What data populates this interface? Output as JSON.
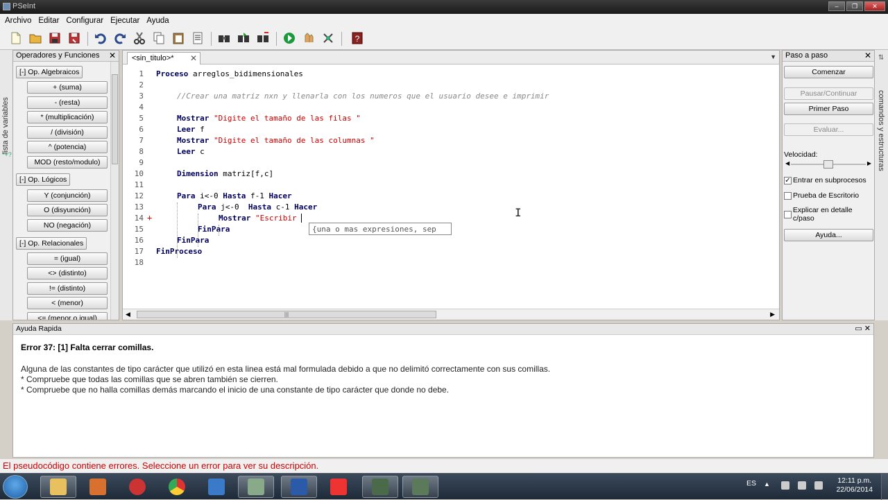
{
  "window": {
    "title": "PSeInt"
  },
  "menu": [
    "Archivo",
    "Editar",
    "Configurar",
    "Ejecutar",
    "Ayuda"
  ],
  "toolbar_icons": [
    "new-file-icon",
    "open-folder-icon",
    "save-icon",
    "save-as-icon",
    "undo-icon",
    "redo-icon",
    "cut-icon",
    "copy-icon",
    "paste-icon",
    "indent-icon",
    "search-icon",
    "find-next-icon",
    "replace-icon",
    "run-icon",
    "step-icon",
    "debug-icon",
    "help-book-icon"
  ],
  "left_tab": {
    "label": "lista de variables",
    "icon_text": "*+?"
  },
  "operators_panel": {
    "title": "Operadores y Funciones",
    "groups": [
      {
        "label": "[-]  Op. Algebraicos",
        "items": [
          "+ (suma)",
          "- (resta)",
          "* (multiplicación)",
          "/ (división)",
          "^ (potencia)",
          "MOD (resto/modulo)"
        ]
      },
      {
        "label": "[-]  Op. Lógicos",
        "items": [
          "Y (conjunción)",
          "O (disyunción)",
          "NO (negación)"
        ]
      },
      {
        "label": "[-]  Op. Relacionales",
        "items": [
          "= (igual)",
          "<> (distinto)",
          "!= (distinto)",
          "< (menor)",
          "<= (menor o igual)"
        ]
      }
    ]
  },
  "editor": {
    "tab_label": "<sin_titulo>*",
    "lines": [
      {
        "n": "1",
        "indent": 0,
        "parts": [
          [
            "kw",
            "Proceso"
          ],
          [
            "t",
            " arreglos_bidimensionales"
          ]
        ]
      },
      {
        "n": "2",
        "indent": 0,
        "parts": []
      },
      {
        "n": "3",
        "indent": 1,
        "parts": [
          [
            "cm",
            "//Crear una matriz nxn y llenarla con los numeros que el usuario desee e imprimir"
          ]
        ]
      },
      {
        "n": "4",
        "indent": 0,
        "parts": []
      },
      {
        "n": "5",
        "indent": 1,
        "parts": [
          [
            "kw",
            "Mostrar"
          ],
          [
            "t",
            " "
          ],
          [
            "str",
            "\"Digite el tamaño de las filas \""
          ]
        ]
      },
      {
        "n": "6",
        "indent": 1,
        "parts": [
          [
            "kw",
            "Leer"
          ],
          [
            "t",
            " f"
          ]
        ]
      },
      {
        "n": "7",
        "indent": 1,
        "parts": [
          [
            "kw",
            "Mostrar"
          ],
          [
            "t",
            " "
          ],
          [
            "str",
            "\"Digite el tamaño de las columnas \""
          ]
        ]
      },
      {
        "n": "8",
        "indent": 1,
        "parts": [
          [
            "kw",
            "Leer"
          ],
          [
            "t",
            " c"
          ]
        ]
      },
      {
        "n": "9",
        "indent": 0,
        "parts": []
      },
      {
        "n": "10",
        "indent": 1,
        "parts": [
          [
            "kw",
            "Dimension"
          ],
          [
            "t",
            " matriz[f,c]"
          ]
        ]
      },
      {
        "n": "11",
        "indent": 0,
        "parts": []
      },
      {
        "n": "12",
        "indent": 1,
        "parts": [
          [
            "kw",
            "Para"
          ],
          [
            "t",
            " i<-0 "
          ],
          [
            "kw",
            "Hasta"
          ],
          [
            "t",
            " f-1 "
          ],
          [
            "kw",
            "Hacer"
          ]
        ]
      },
      {
        "n": "13",
        "indent": 2,
        "parts": [
          [
            "kw",
            "Para"
          ],
          [
            "t",
            " j<-0  "
          ],
          [
            "kw",
            "Hasta"
          ],
          [
            "t",
            " c-1 "
          ],
          [
            "kw",
            "Hacer"
          ]
        ]
      },
      {
        "n": "14",
        "indent": 3,
        "parts": [
          [
            "kw",
            "Mostrar"
          ],
          [
            "t",
            " "
          ],
          [
            "str",
            "\"Escribir "
          ]
        ]
      },
      {
        "n": "15",
        "indent": 2,
        "parts": [
          [
            "kw",
            "FinPara"
          ]
        ]
      },
      {
        "n": "16",
        "indent": 1,
        "parts": [
          [
            "kw",
            "FinPara"
          ]
        ]
      },
      {
        "n": "17",
        "indent": 0,
        "parts": [
          [
            "kw",
            "FinProceso"
          ]
        ]
      },
      {
        "n": "18",
        "indent": 0,
        "parts": []
      }
    ],
    "error_marker": "+",
    "autocomplete": "{una o mas expresiones, sep"
  },
  "step_panel": {
    "title": "Paso a paso",
    "start_button": "Comenzar",
    "pause_button": "Pausar/Continuar",
    "first_step_button": "Primer Paso",
    "evaluate_button": "Evaluar...",
    "speed_label": "Velocidad:",
    "speed_level": 0.5,
    "checkboxes": [
      {
        "label": "Entrar en subprocesos",
        "checked": true
      },
      {
        "label": "Prueba de Escritorio",
        "checked": false
      },
      {
        "label": "Explicar en detalle c/paso",
        "checked": false
      }
    ],
    "help_button": "Ayuda..."
  },
  "right_tab": {
    "label": "comandos y estructuras"
  },
  "quick_help": {
    "title": "Ayuda Rapida",
    "error_title": "Error 37: [1] Falta cerrar comillas.",
    "lines": [
      "Alguna de las constantes de tipo carácter que utilizó en esta linea está mal formulada debido a que no delimitó correctamente con sus comillas.",
      "* Compruebe que todas las comillas que se abren también se cierren.",
      "* Compruebe que no halla comillas demás marcando el inicio de una constante de tipo carácter que donde no debe."
    ]
  },
  "status_bar": {
    "text": "El pseudocódigo contiene errores. Seleccione un error para ver su descripción."
  },
  "taskbar": {
    "apps": [
      "explorer-icon",
      "media-player-icon",
      "snipping-tool-icon",
      "chrome-icon",
      "movie-maker-icon",
      "pseint-icon",
      "word-icon",
      "acrobat-icon",
      "pseint-window-icon",
      "pseint-run-icon"
    ],
    "language": "ES",
    "time": "12:11 p.m.",
    "date": "22/06/2014"
  }
}
